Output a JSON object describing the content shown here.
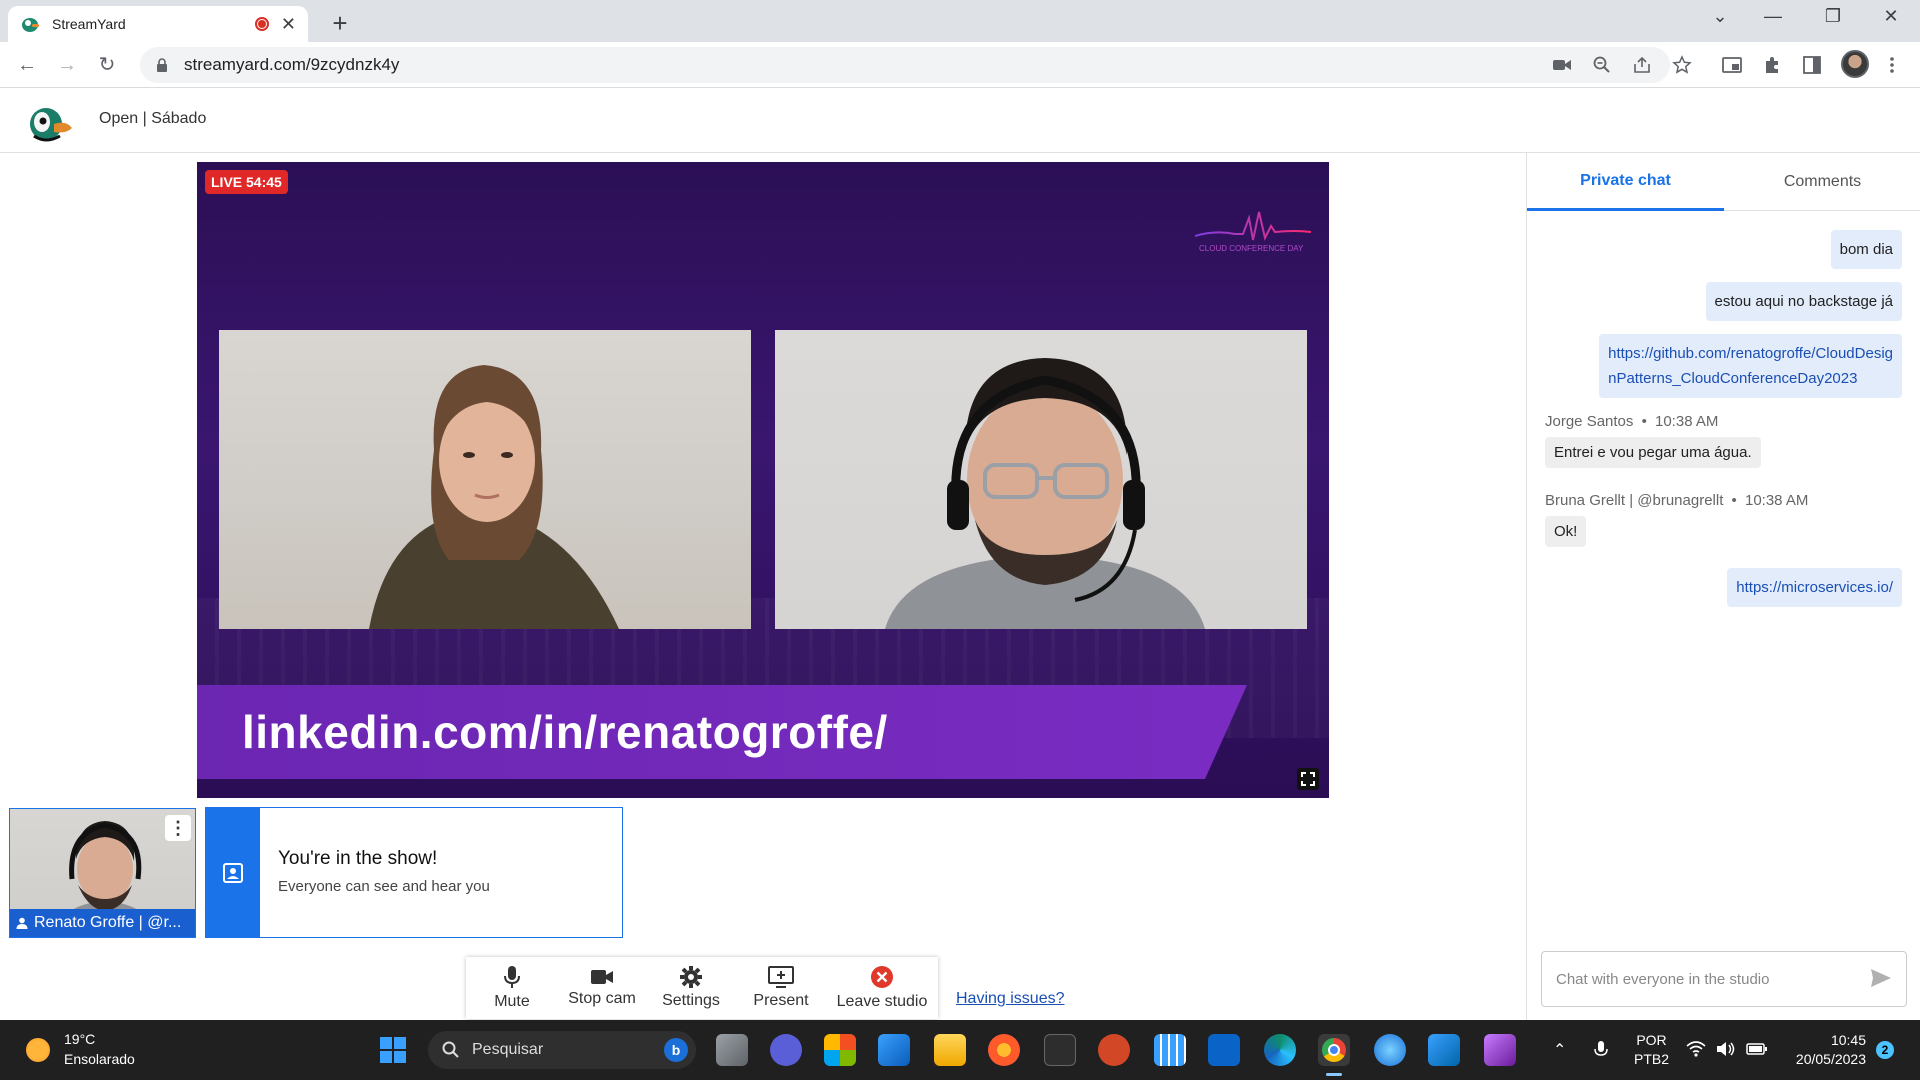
{
  "browser": {
    "tab_title": "StreamYard",
    "url": "streamyard.com/9zcydnzk4y"
  },
  "studio": {
    "broadcast_title": "Open | Sábado",
    "live_badge": "LIVE 54:45",
    "banner_text": "linkedin.com/in/renatogroffe/",
    "event_logo_caption": "CLOUD CONFERENCE DAY",
    "participant_name": "Renato Groffe | @r...",
    "show_card": {
      "heading": "You're in the show!",
      "subtext": "Everyone can see and hear you"
    },
    "controls": {
      "mute": "Mute",
      "stop_cam": "Stop cam",
      "settings": "Settings",
      "present": "Present",
      "leave": "Leave studio"
    },
    "having_issues": "Having issues?"
  },
  "chat": {
    "tabs": {
      "private": "Private chat",
      "comments": "Comments"
    },
    "messages": {
      "m1": "bom dia",
      "m2": "estou aqui no backstage já",
      "m3_line1": "https://github.com/renatogroffe/CloudDesig",
      "m3_line2": "nPatterns_CloudConferenceDay2023",
      "m4_author": "Jorge Santos",
      "m4_time": "10:38 AM",
      "m4_text": "Entrei e vou pegar uma água.",
      "m5_author": "Bruna Grellt | @brunagrellt",
      "m5_time": "10:38 AM",
      "m5_text": "Ok!",
      "m6": "https://microservices.io/"
    },
    "input_placeholder": "Chat with everyone in the studio"
  },
  "taskbar": {
    "weather_temp": "19°C",
    "weather_desc": "Ensolarado",
    "search_placeholder": "Pesquisar",
    "lang_1": "POR",
    "lang_2": "PTB2",
    "time": "10:45",
    "date": "20/05/2023",
    "notification_count": "2"
  },
  "colors": {
    "accent": "#1a73e8",
    "live_red": "#e02828",
    "stage_purple": "#3a1670",
    "banner_purple": "#7a2cc2"
  }
}
